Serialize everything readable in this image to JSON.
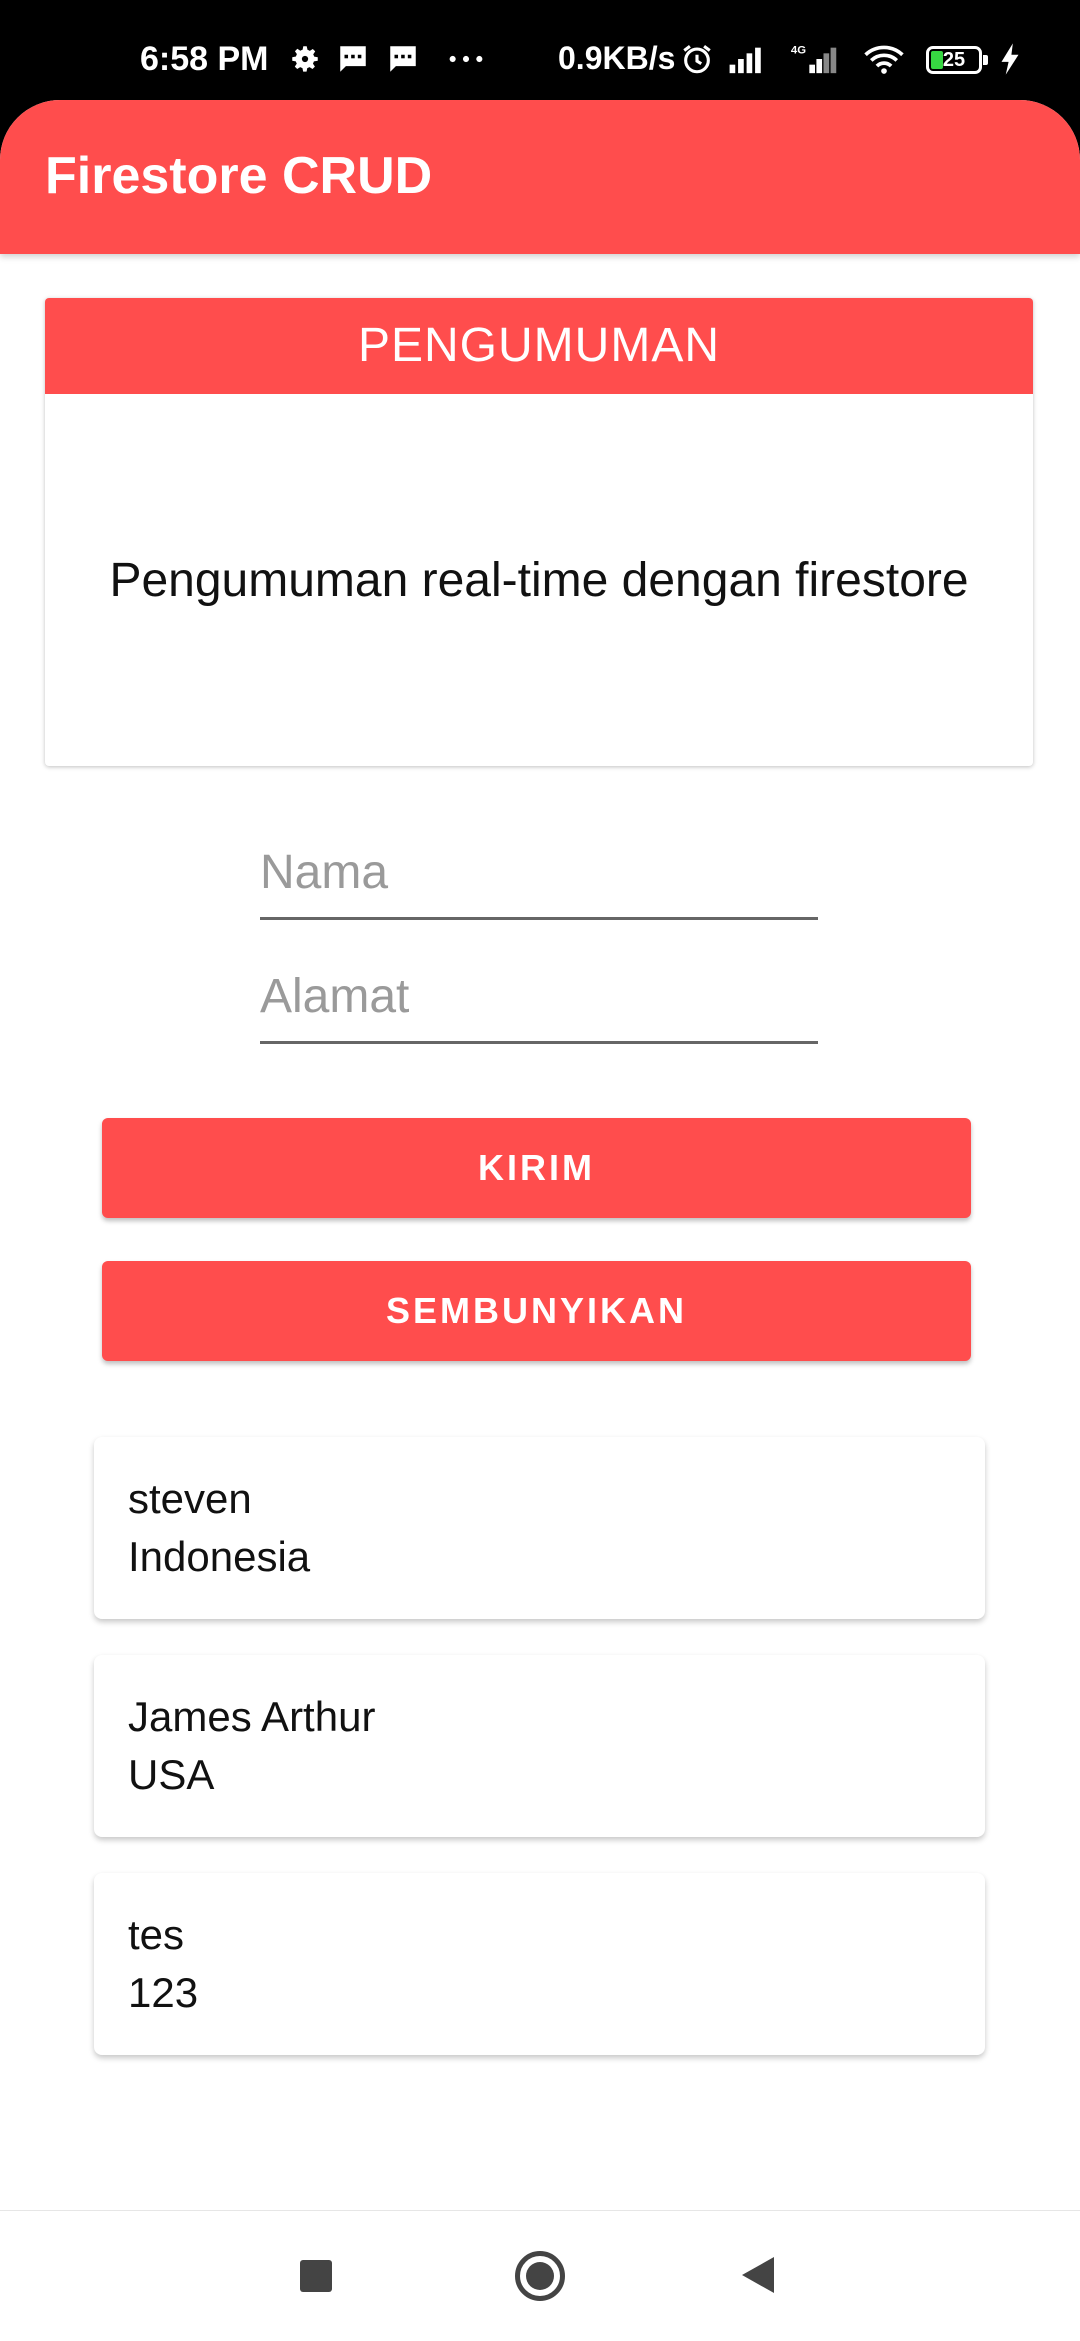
{
  "status_bar": {
    "time": "6:58 PM",
    "net_speed": "0.9KB/s",
    "battery_level": "25",
    "icons": [
      "gear-icon",
      "message-icon",
      "message-icon",
      "more-dots-icon",
      "alarm-icon",
      "signal-icon",
      "4g-signal-icon",
      "wifi-icon",
      "battery-icon",
      "charging-icon"
    ]
  },
  "app_bar": {
    "title": "Firestore CRUD"
  },
  "announcement": {
    "header": "PENGUMUMAN",
    "body": "Pengumuman real-time dengan firestore"
  },
  "form": {
    "name_placeholder": "Nama",
    "name_value": "",
    "address_placeholder": "Alamat",
    "address_value": ""
  },
  "buttons": {
    "send_label": "KIRIM",
    "hide_label": "SEMBUNYIKAN"
  },
  "items": [
    {
      "name": "steven",
      "address": "Indonesia"
    },
    {
      "name": "James Arthur",
      "address": "USA"
    },
    {
      "name": "tes",
      "address": "123"
    }
  ],
  "colors": {
    "accent": "#ff4d4d",
    "background": "#ffffff",
    "text": "#111111"
  }
}
